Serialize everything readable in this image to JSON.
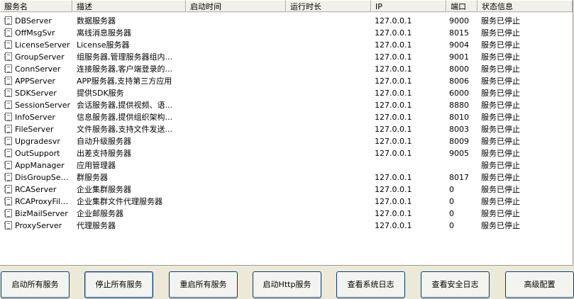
{
  "columns": {
    "name": "服务名",
    "desc": "描述",
    "start": "启动时间",
    "run": "运行时长",
    "ip": "IP",
    "port": "端口",
    "status": "状态信息"
  },
  "rows": [
    {
      "name": "DBServer",
      "desc": "数据服务器",
      "start": "",
      "run": "",
      "ip": "127.0.0.1",
      "port": "9000",
      "status": "服务已停止"
    },
    {
      "name": "OffMsgSvr",
      "desc": "离线消息服务器",
      "start": "",
      "run": "",
      "ip": "127.0.0.1",
      "port": "8015",
      "status": "服务已停止"
    },
    {
      "name": "LicenseServer",
      "desc": "License服务器",
      "start": "",
      "run": "",
      "ip": "127.0.0.1",
      "port": "9004",
      "status": "服务已停止"
    },
    {
      "name": "GroupServer",
      "desc": "组服务器,管理服务器组内...",
      "start": "",
      "run": "",
      "ip": "127.0.0.1",
      "port": "9001",
      "status": "服务已停止"
    },
    {
      "name": "ConnServer",
      "desc": "连接服务器,客户端登录的...",
      "start": "",
      "run": "",
      "ip": "127.0.0.1",
      "port": "8000",
      "status": "服务已停止"
    },
    {
      "name": "APPServer",
      "desc": "APP服务器,支持第三方应用",
      "start": "",
      "run": "",
      "ip": "127.0.0.1",
      "port": "8006",
      "status": "服务已停止"
    },
    {
      "name": "SDKServer",
      "desc": "提供SDK服务",
      "start": "",
      "run": "",
      "ip": "127.0.0.1",
      "port": "6000",
      "status": "服务已停止"
    },
    {
      "name": "SessionServer",
      "desc": "会话服务器,提供视频、语...",
      "start": "",
      "run": "",
      "ip": "127.0.0.1",
      "port": "8880",
      "status": "服务已停止"
    },
    {
      "name": "InfoServer",
      "desc": "信息服务器,提供组织架构...",
      "start": "",
      "run": "",
      "ip": "127.0.0.1",
      "port": "8010",
      "status": "服务已停止"
    },
    {
      "name": "FileServer",
      "desc": "文件服务器,支持文件发送...",
      "start": "",
      "run": "",
      "ip": "127.0.0.1",
      "port": "8003",
      "status": "服务已停止"
    },
    {
      "name": "Upgradesvr",
      "desc": "自动升级服务器",
      "start": "",
      "run": "",
      "ip": "127.0.0.1",
      "port": "8009",
      "status": "服务已停止"
    },
    {
      "name": "OutSupport",
      "desc": "出差支持服务器",
      "start": "",
      "run": "",
      "ip": "127.0.0.1",
      "port": "9005",
      "status": "服务已停止"
    },
    {
      "name": "AppManager",
      "desc": "应用管理器",
      "start": "",
      "run": "",
      "ip": "",
      "port": "",
      "status": "服务已停止"
    },
    {
      "name": "DisGroupServer",
      "desc": "群服务器",
      "start": "",
      "run": "",
      "ip": "127.0.0.1",
      "port": "8017",
      "status": "服务已停止"
    },
    {
      "name": "RCAServer",
      "desc": "企业集群服务器",
      "start": "",
      "run": "",
      "ip": "127.0.0.1",
      "port": "0",
      "status": "服务已停止"
    },
    {
      "name": "RCAProxyFile...",
      "desc": "企业集群文件代理服务器",
      "start": "",
      "run": "",
      "ip": "127.0.0.1",
      "port": "0",
      "status": "服务已停止"
    },
    {
      "name": "BizMailServer",
      "desc": "企业邮服务器",
      "start": "",
      "run": "",
      "ip": "127.0.0.1",
      "port": "0",
      "status": "服务已停止"
    },
    {
      "name": "ProxyServer",
      "desc": "代理服务器",
      "start": "",
      "run": "",
      "ip": "127.0.0.1",
      "port": "0",
      "status": "服务已停止"
    }
  ],
  "buttons": {
    "start_all": "启动所有服务",
    "stop_all": "停止所有服务",
    "restart_all": "重启所有服务",
    "start_http": "启动Http服务",
    "view_system_log": "查看系统日志",
    "view_security_log": "查看安全日志",
    "advanced": "高级配置"
  },
  "row_icon": "service-config-file-icon"
}
